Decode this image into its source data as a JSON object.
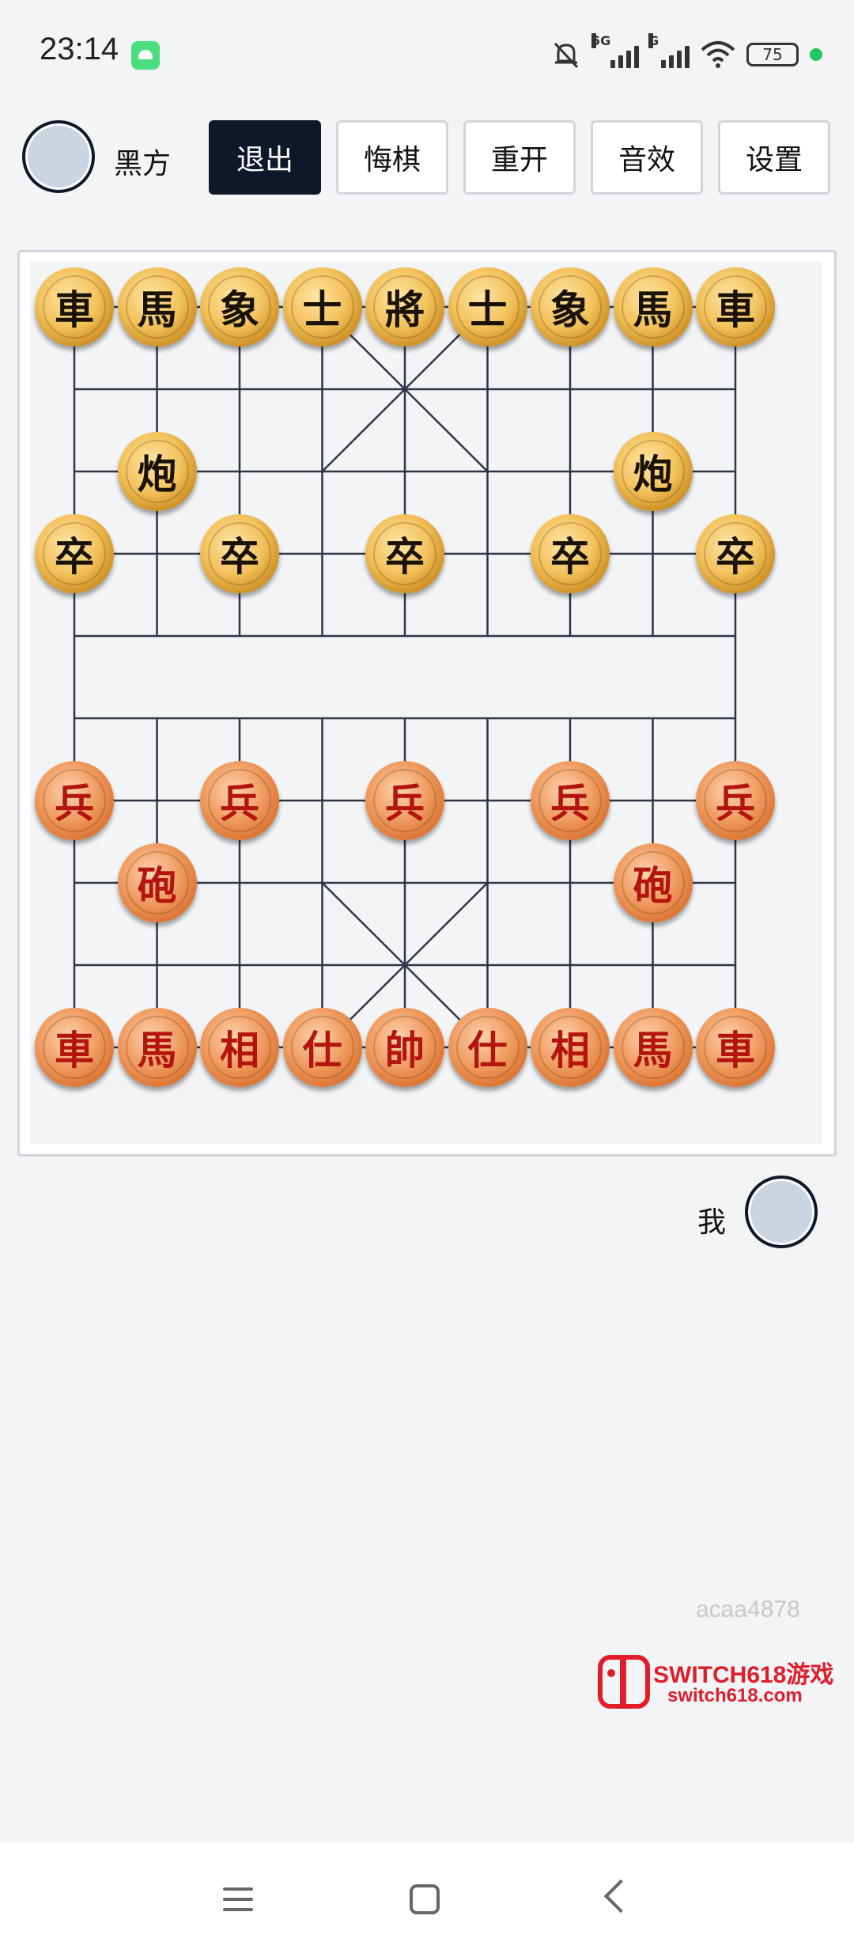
{
  "status_bar": {
    "time": "23:14",
    "network_1": "5G",
    "network_2": "G",
    "battery": "75",
    "icons": [
      "android-app-icon",
      "bell-off-icon",
      "signal-icon",
      "signal-icon",
      "wifi-icon",
      "battery-icon"
    ]
  },
  "top_bar": {
    "opponent_name": "黑方",
    "buttons": {
      "exit": "退出",
      "undo": "悔棋",
      "restart": "重开",
      "sound": "音效",
      "settings": "设置"
    }
  },
  "bottom_player": {
    "name": "我"
  },
  "board": {
    "grid": "9x10",
    "pieces": [
      {
        "side": "black",
        "char": "車",
        "file": 0,
        "rank": 0
      },
      {
        "side": "black",
        "char": "馬",
        "file": 1,
        "rank": 0
      },
      {
        "side": "black",
        "char": "象",
        "file": 2,
        "rank": 0
      },
      {
        "side": "black",
        "char": "士",
        "file": 3,
        "rank": 0
      },
      {
        "side": "black",
        "char": "將",
        "file": 4,
        "rank": 0
      },
      {
        "side": "black",
        "char": "士",
        "file": 5,
        "rank": 0
      },
      {
        "side": "black",
        "char": "象",
        "file": 6,
        "rank": 0
      },
      {
        "side": "black",
        "char": "馬",
        "file": 7,
        "rank": 0
      },
      {
        "side": "black",
        "char": "車",
        "file": 8,
        "rank": 0
      },
      {
        "side": "black",
        "char": "炮",
        "file": 1,
        "rank": 2
      },
      {
        "side": "black",
        "char": "炮",
        "file": 7,
        "rank": 2
      },
      {
        "side": "black",
        "char": "卒",
        "file": 0,
        "rank": 3
      },
      {
        "side": "black",
        "char": "卒",
        "file": 2,
        "rank": 3
      },
      {
        "side": "black",
        "char": "卒",
        "file": 4,
        "rank": 3
      },
      {
        "side": "black",
        "char": "卒",
        "file": 6,
        "rank": 3
      },
      {
        "side": "black",
        "char": "卒",
        "file": 8,
        "rank": 3
      },
      {
        "side": "red",
        "char": "兵",
        "file": 0,
        "rank": 6
      },
      {
        "side": "red",
        "char": "兵",
        "file": 2,
        "rank": 6
      },
      {
        "side": "red",
        "char": "兵",
        "file": 4,
        "rank": 6
      },
      {
        "side": "red",
        "char": "兵",
        "file": 6,
        "rank": 6
      },
      {
        "side": "red",
        "char": "兵",
        "file": 8,
        "rank": 6
      },
      {
        "side": "red",
        "char": "砲",
        "file": 1,
        "rank": 7
      },
      {
        "side": "red",
        "char": "砲",
        "file": 7,
        "rank": 7
      },
      {
        "side": "red",
        "char": "車",
        "file": 0,
        "rank": 9
      },
      {
        "side": "red",
        "char": "馬",
        "file": 1,
        "rank": 9
      },
      {
        "side": "red",
        "char": "相",
        "file": 2,
        "rank": 9
      },
      {
        "side": "red",
        "char": "仕",
        "file": 3,
        "rank": 9
      },
      {
        "side": "red",
        "char": "帥",
        "file": 4,
        "rank": 9
      },
      {
        "side": "red",
        "char": "仕",
        "file": 5,
        "rank": 9
      },
      {
        "side": "red",
        "char": "相",
        "file": 6,
        "rank": 9
      },
      {
        "side": "red",
        "char": "馬",
        "file": 7,
        "rank": 9
      },
      {
        "side": "red",
        "char": "車",
        "file": 8,
        "rank": 9
      }
    ]
  },
  "watermark": "acaa4878",
  "logo": {
    "title": "SWITCH618游戏",
    "url": "switch618.com"
  },
  "colors": {
    "background": "#f3f4f6",
    "primary_button": "#0f172a",
    "grid_line": "#2f3548",
    "black_piece_text": "#1a1204",
    "red_piece_text": "#b3140e",
    "logo_red": "#e11d2a"
  }
}
